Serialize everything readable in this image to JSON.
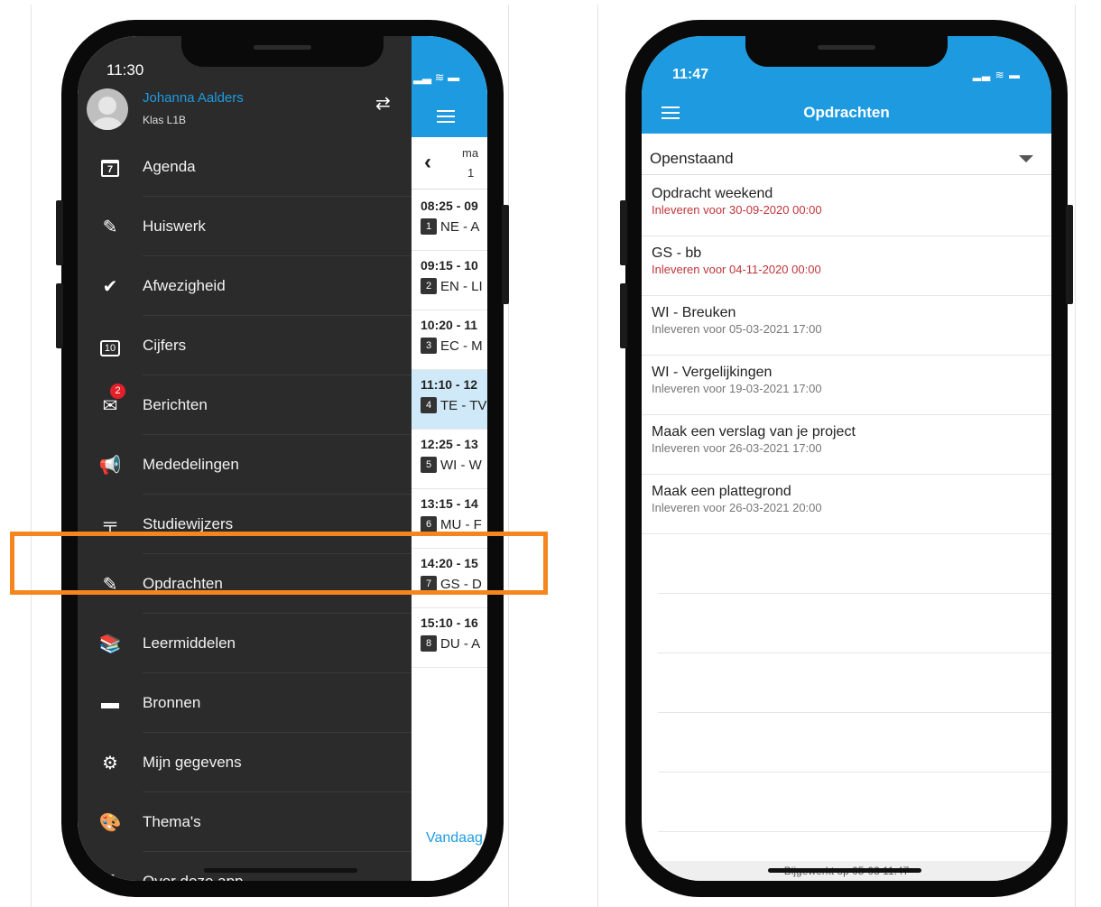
{
  "left_phone": {
    "status_time": "11:30",
    "user": {
      "name": "Johanna Aalders",
      "class": "Klas L1B"
    },
    "menu": [
      {
        "label": "Agenda",
        "icon": "calendar-icon"
      },
      {
        "label": "Huiswerk",
        "icon": "edit-icon"
      },
      {
        "label": "Afwezigheid",
        "icon": "check-circle-icon"
      },
      {
        "label": "Cijfers",
        "icon": "grades-icon"
      },
      {
        "label": "Berichten",
        "icon": "mail-icon",
        "badge": "2"
      },
      {
        "label": "Mededelingen",
        "icon": "megaphone-icon"
      },
      {
        "label": "Studiewijzers",
        "icon": "signpost-icon"
      },
      {
        "label": "Opdrachten",
        "icon": "edit-icon"
      },
      {
        "label": "Leermiddelen",
        "icon": "books-icon"
      },
      {
        "label": "Bronnen",
        "icon": "folder-icon"
      },
      {
        "label": "Mijn gegevens",
        "icon": "gear-icon"
      },
      {
        "label": "Thema's",
        "icon": "palette-icon"
      },
      {
        "label": "Over deze app",
        "icon": "app-logo-icon"
      }
    ],
    "calendar": {
      "day_abbr": "ma",
      "day_num": "1",
      "lessons": [
        {
          "time": "08:25 - 09",
          "num": "1",
          "subject": "NE - A"
        },
        {
          "time": "09:15 - 10",
          "num": "2",
          "subject": "EN - LI"
        },
        {
          "time": "10:20 - 11",
          "num": "3",
          "subject": "EC - M"
        },
        {
          "time": "11:10 - 12",
          "num": "4",
          "subject": "TE - TV"
        },
        {
          "time": "12:25 - 13",
          "num": "5",
          "subject": "WI - W"
        },
        {
          "time": "13:15 - 14",
          "num": "6",
          "subject": "MU - F"
        },
        {
          "time": "14:20 - 15",
          "num": "7",
          "subject": "GS - D"
        },
        {
          "time": "15:10 - 16",
          "num": "8",
          "subject": "DU - A"
        }
      ],
      "today_label": "Vandaag"
    }
  },
  "right_phone": {
    "status_time": "11:47",
    "title": "Opdrachten",
    "filter": "Openstaand",
    "assignments": [
      {
        "title": "Opdracht weekend",
        "due": "Inleveren voor 30-09-2020 00:00",
        "overdue": true
      },
      {
        "title": "GS - bb",
        "due": "Inleveren voor 04-11-2020 00:00",
        "overdue": true
      },
      {
        "title": "WI - Breuken",
        "due": "Inleveren voor 05-03-2021 17:00",
        "overdue": false
      },
      {
        "title": "WI - Vergelijkingen",
        "due": "Inleveren voor 19-03-2021 17:00",
        "overdue": false
      },
      {
        "title": "Maak een verslag van je project",
        "due": "Inleveren voor 26-03-2021 17:00",
        "overdue": false
      },
      {
        "title": "Maak een plattegrond",
        "due": "Inleveren voor 26-03-2021 20:00",
        "overdue": false
      }
    ],
    "footer": "Bijgewerkt op 05-03 11:47"
  },
  "colors": {
    "accent": "#1e9be0",
    "drawer": "#2b2b2b",
    "highlight": "#f5861f",
    "overdue": "#c0343a"
  }
}
